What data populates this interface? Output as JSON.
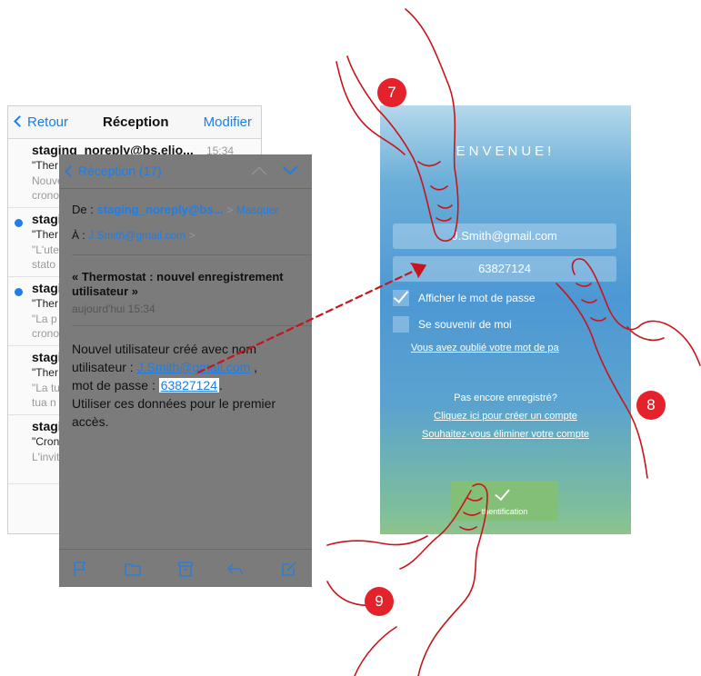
{
  "inbox": {
    "back_label": "Retour",
    "title": "Réception",
    "edit_label": "Modifier",
    "items": [
      {
        "from": "staging_noreply@bs.elio...",
        "time": "15:34",
        "subject": "\"Ther",
        "preview": [
          "Nouve",
          "crono"
        ],
        "unread": false
      },
      {
        "from": "stagi",
        "subject": "\"Ther",
        "preview": [
          "\"L'ute",
          "stato"
        ],
        "unread": true
      },
      {
        "from": "stagi",
        "subject": "\"Ther",
        "preview": [
          "\"La p",
          "crono"
        ],
        "unread": true
      },
      {
        "from": "stagi",
        "subject": "\"Ther",
        "preview": [
          "\"La tu",
          "tua n"
        ],
        "unread": false
      },
      {
        "from": "stagi",
        "subject": "\"Cron",
        "preview": [
          "L'invit",
          ""
        ],
        "unread": false
      }
    ]
  },
  "detail": {
    "back_label": "Réception (17)",
    "from_label": "De :",
    "from_address": "staging_noreply@bs...",
    "hide_label": "Masquer",
    "to_label": "À :",
    "to_address": "J.Smith@gmail.com",
    "subject": "« Thermostat : nouvel enregistrement utilisateur »",
    "date": "aujourd'hui 15:34",
    "body": {
      "line1": "Nouvel utilisateur créé avec nom",
      "line2_prefix": "utilisateur :",
      "username": "J.Smith@gmail.com",
      "line2_suffix": ",",
      "line3_prefix": "mot de passe :",
      "password": "63827124",
      "line3_suffix": ".",
      "line4": "Utiliser ces données pour le premier",
      "line5": "accès."
    },
    "toolbar_icons": [
      "flag-icon",
      "folder-icon",
      "archive-icon",
      "reply-icon",
      "compose-icon"
    ]
  },
  "app": {
    "welcome": "ENVENUE!",
    "email_value": "J.Smith@gmail.com",
    "password_value": "63827124",
    "show_password_label": "Afficher le mot de passe",
    "show_password_checked": true,
    "remember_label": "Se souvenir de moi",
    "remember_checked": false,
    "forgot_link": "Vous avez oublié votre mot de pa",
    "not_registered": "Pas encore enregistré?",
    "create_account_link": "Cliquez ici pour créer un compte",
    "delete_account_link": "Souhaitez-vous éliminer votre compte",
    "auth_button_label": "thentification"
  },
  "markers": {
    "step7": "7",
    "step8": "8",
    "step9": "9"
  },
  "colors": {
    "accent_blue": "#1e7ee6",
    "marker_red": "#e3222b",
    "hand_line": "#c8141c",
    "auth_green": "#84bf78"
  }
}
